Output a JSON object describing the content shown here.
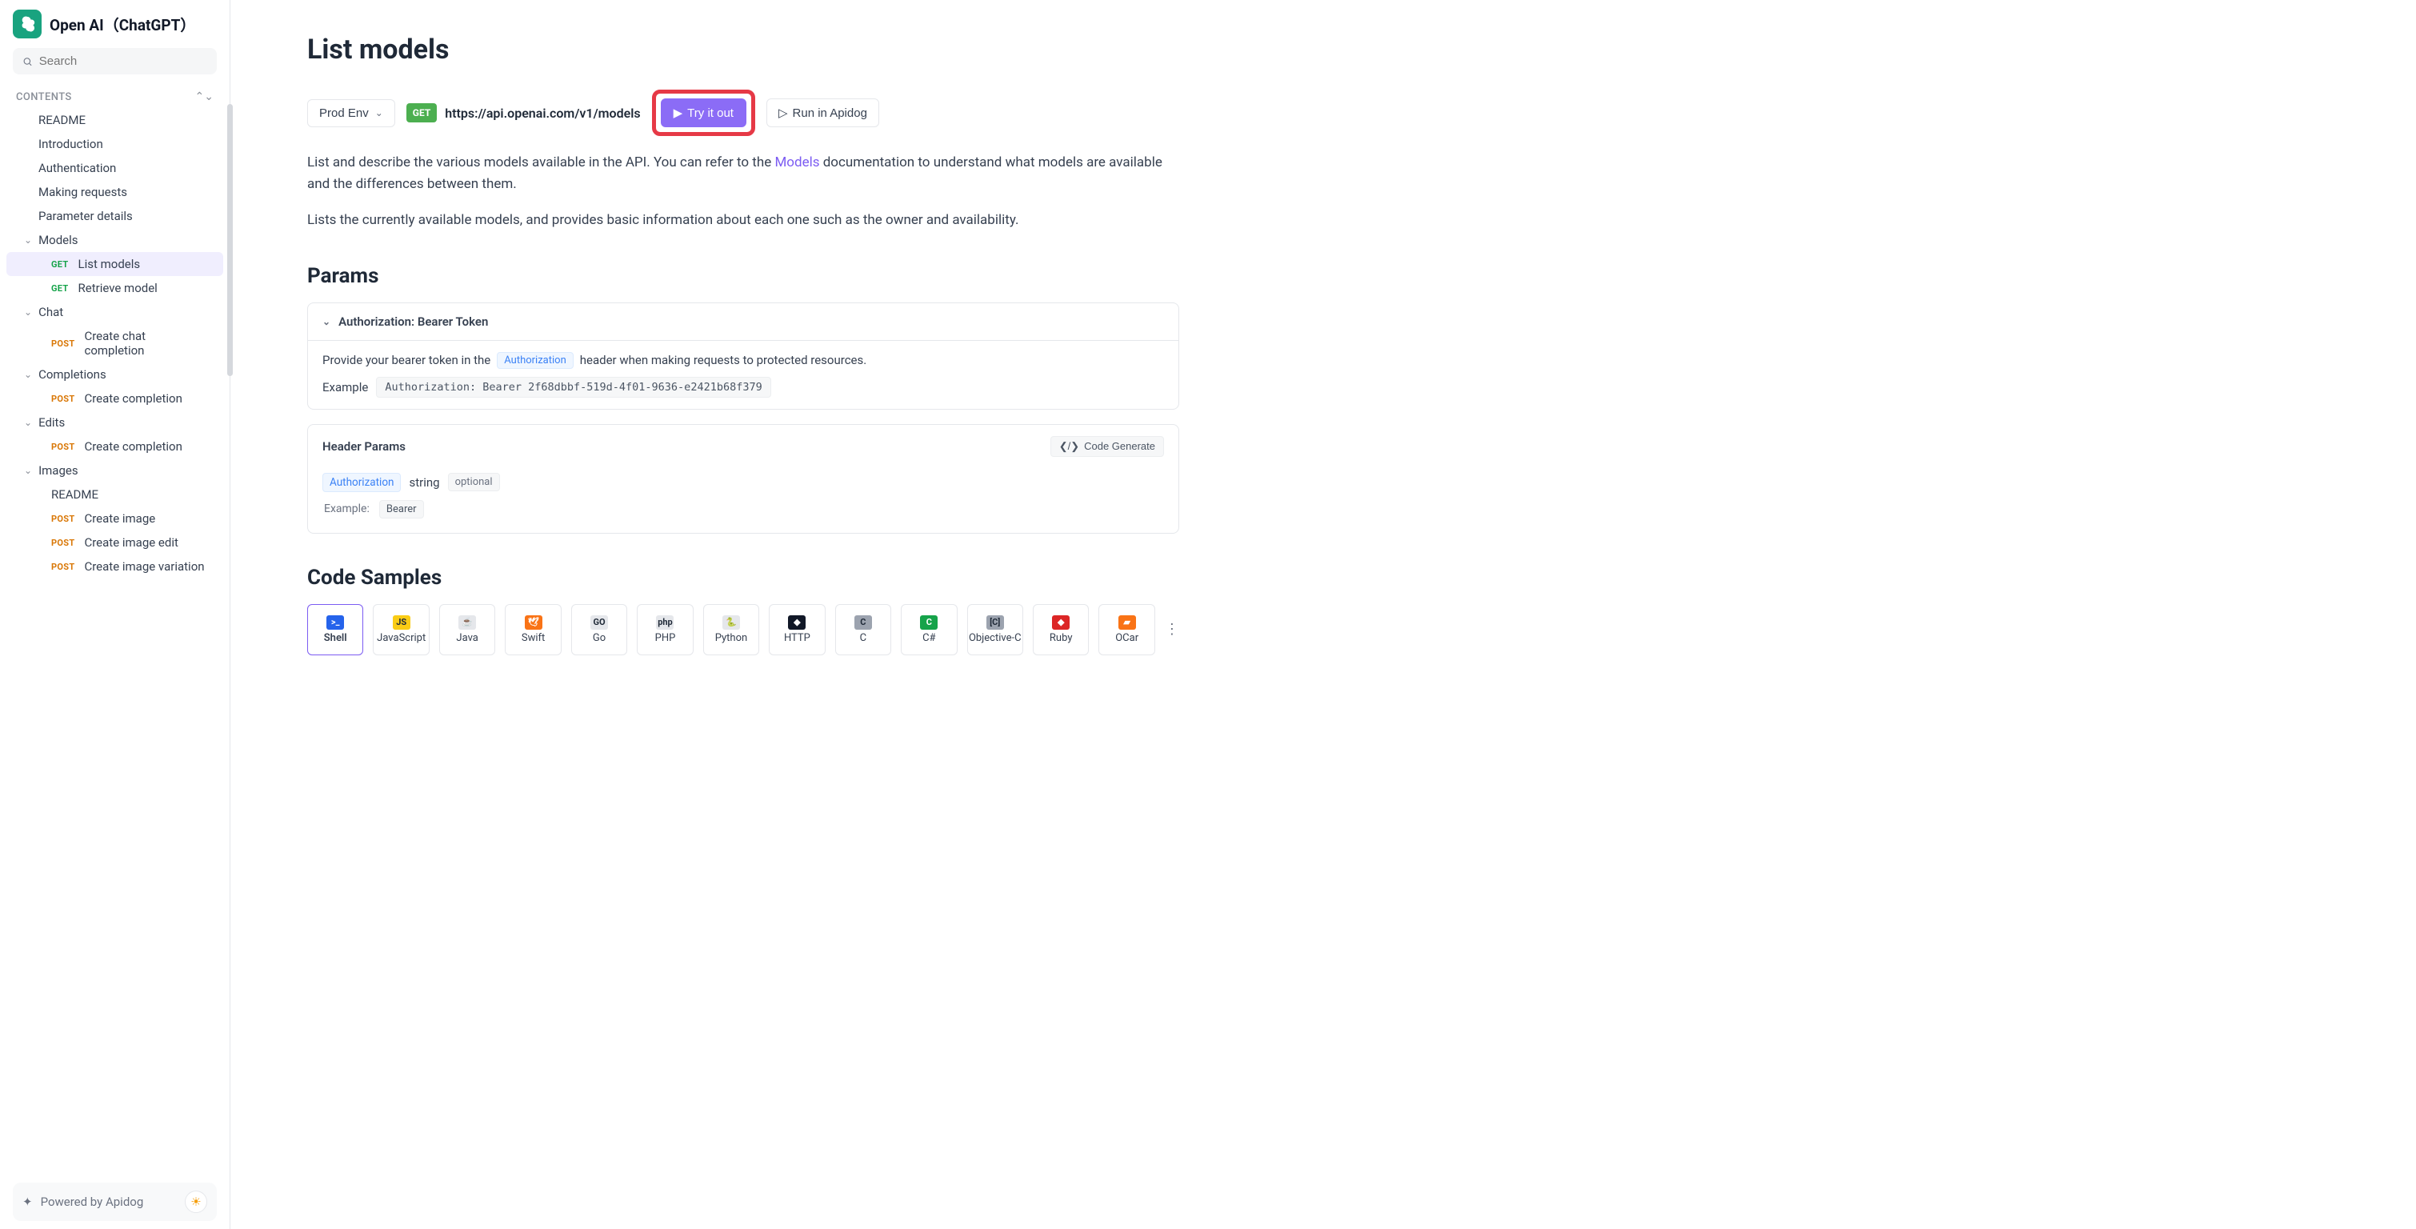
{
  "brand": {
    "title": "Open AI（ChatGPT）"
  },
  "search": {
    "placeholder": "Search"
  },
  "contents_label": "CONTENTS",
  "nav": {
    "plain": [
      "README",
      "Introduction",
      "Authentication",
      "Making requests",
      "Parameter details"
    ],
    "groups": [
      {
        "label": "Models",
        "items": [
          {
            "method": "GET",
            "label": "List models",
            "active": true
          },
          {
            "method": "GET",
            "label": "Retrieve model"
          }
        ]
      },
      {
        "label": "Chat",
        "items": [
          {
            "method": "POST",
            "label": "Create chat completion"
          }
        ]
      },
      {
        "label": "Completions",
        "items": [
          {
            "method": "POST",
            "label": "Create completion"
          }
        ]
      },
      {
        "label": "Edits",
        "items": [
          {
            "method": "POST",
            "label": "Create completion"
          }
        ]
      },
      {
        "label": "Images",
        "items": [
          {
            "method": "",
            "label": "README"
          },
          {
            "method": "POST",
            "label": "Create image"
          },
          {
            "method": "POST",
            "label": "Create image edit"
          },
          {
            "method": "POST",
            "label": "Create image variation"
          }
        ]
      }
    ]
  },
  "footer": {
    "text": "Powered by Apidog"
  },
  "page": {
    "title": "List models",
    "env": "Prod Env",
    "method": "GET",
    "url": "https://api.openai.com/v1/models",
    "try_label": "Try it out",
    "run_label": "Run in Apidog",
    "desc_pre": "List and describe the various models available in the API. You can refer to the ",
    "desc_link": "Models",
    "desc_post": " documentation to understand what models are available and the differences between them.",
    "desc2": "Lists the currently available models, and provides basic information about each one such as the owner and availability."
  },
  "params": {
    "heading": "Params",
    "auth_section": {
      "title": "Authorization: Bearer Token",
      "line_pre": "Provide your bearer token in the ",
      "line_tag": "Authorization",
      "line_post": " header when making requests to protected resources.",
      "example_label": "Example",
      "example_value": "Authorization: Bearer 2f68dbbf-519d-4f01-9636-e2421b68f379"
    },
    "header_section": {
      "title": "Header Params",
      "gen_label": "Code Generate",
      "param_name": "Authorization",
      "type": "string",
      "optional": "optional",
      "example_label": "Example:",
      "example_value": "Bearer"
    }
  },
  "code_samples": {
    "heading": "Code Samples",
    "langs": [
      {
        "label": "Shell",
        "color": "#2563eb",
        "glyph": ">_",
        "active": true
      },
      {
        "label": "JavaScript",
        "color": "#facc15",
        "glyph": "JS"
      },
      {
        "label": "Java",
        "color": "#e5e7eb",
        "glyph": "☕"
      },
      {
        "label": "Swift",
        "color": "#f97316",
        "glyph": "🕊"
      },
      {
        "label": "Go",
        "color": "#e5e7eb",
        "glyph": "GO"
      },
      {
        "label": "PHP",
        "color": "#e5e7eb",
        "glyph": "php"
      },
      {
        "label": "Python",
        "color": "#e5e7eb",
        "glyph": "🐍"
      },
      {
        "label": "HTTP",
        "color": "#111827",
        "glyph": "◆"
      },
      {
        "label": "C",
        "color": "#9ca3af",
        "glyph": "C"
      },
      {
        "label": "C#",
        "color": "#16a34a",
        "glyph": "C"
      },
      {
        "label": "Objective-C",
        "color": "#9ca3af",
        "glyph": "[C]"
      },
      {
        "label": "Ruby",
        "color": "#dc2626",
        "glyph": "◆"
      },
      {
        "label": "OCar",
        "color": "#f97316",
        "glyph": "▰"
      }
    ]
  }
}
